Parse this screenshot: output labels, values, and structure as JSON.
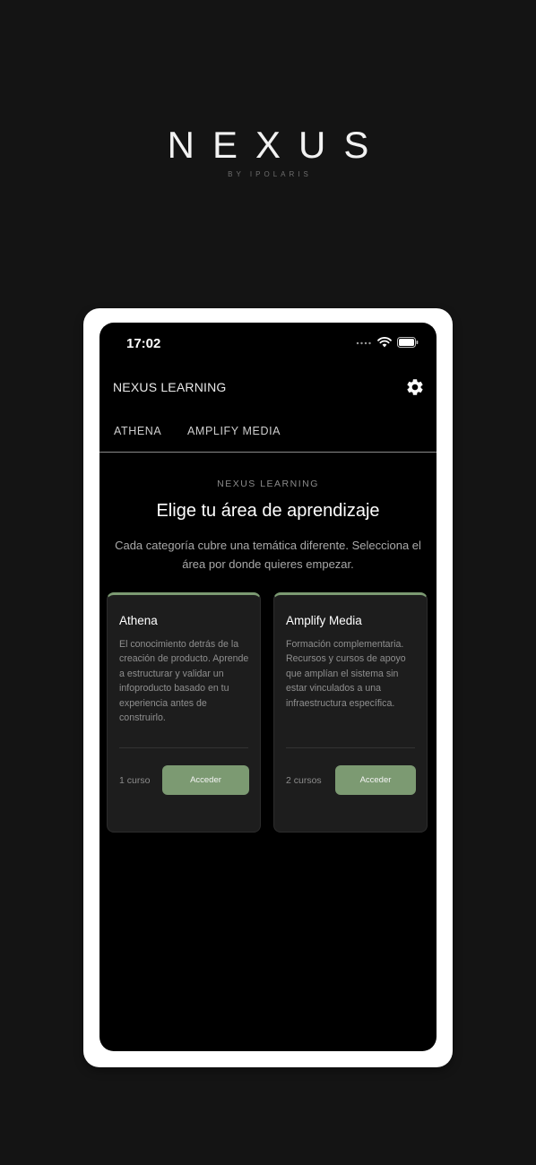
{
  "brand": {
    "name": "NEXUS",
    "tagline": "BY IPOLARIS"
  },
  "status_bar": {
    "time": "17:02"
  },
  "app_bar": {
    "title": "NEXUS LEARNING",
    "settings_icon": "gear-icon"
  },
  "tabs": [
    {
      "label": "ATHENA"
    },
    {
      "label": "AMPLIFY MEDIA"
    }
  ],
  "main": {
    "overline": "NEXUS LEARNING",
    "heading": "Elige tu área de aprendizaje",
    "subtitle": "Cada categoría cubre una temática diferente. Selecciona el área por donde quieres empezar."
  },
  "cards": [
    {
      "title": "Athena",
      "description": "El conocimiento detrás de la creación de producto. Aprende a estructurar y validar un infoproducto basado en tu experiencia antes de construirlo.",
      "count": "1 curso",
      "button_label": "Acceder"
    },
    {
      "title": "Amplify Media",
      "description": "Formación complementaria. Recursos y cursos de apoyo que amplían el sistema sin estar vinculados a una infraestructura específica.",
      "count": "2 cursos",
      "button_label": "Acceder"
    }
  ],
  "colors": {
    "background": "#141414",
    "screen": "#000000",
    "accent": "#7c9a72",
    "card": "#1d1d1d"
  }
}
